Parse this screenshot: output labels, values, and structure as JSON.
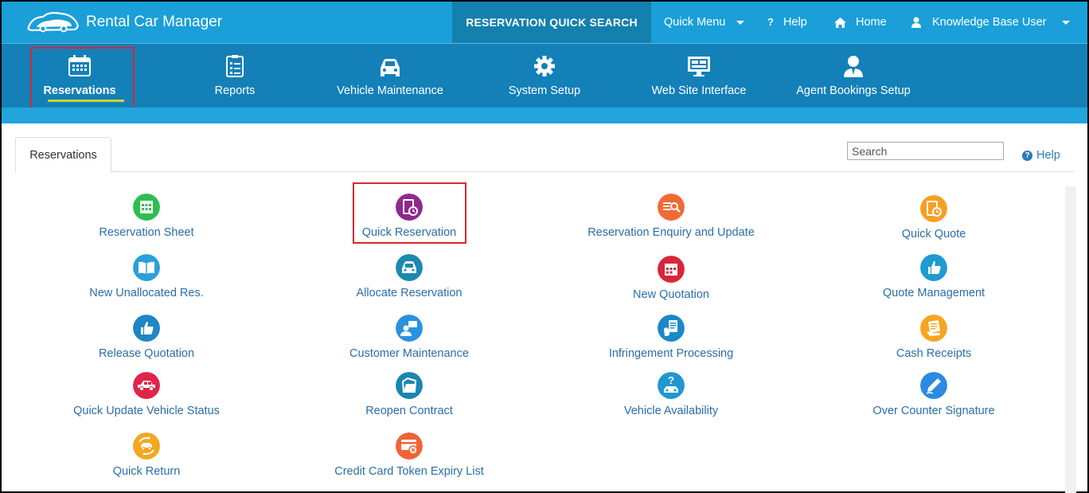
{
  "topbar": {
    "app_title": "Rental Car Manager",
    "quick_search": "RESERVATION QUICK SEARCH",
    "quick_menu": "Quick Menu",
    "help": "Help",
    "home": "Home",
    "user": "Knowledge Base User"
  },
  "nav": {
    "items": [
      {
        "label": "Reservations",
        "icon": "calendar-icon"
      },
      {
        "label": "Reports",
        "icon": "checklist-icon"
      },
      {
        "label": "Vehicle Maintenance",
        "icon": "car-icon"
      },
      {
        "label": "System Setup",
        "icon": "gear-icon"
      },
      {
        "label": "Web Site Interface",
        "icon": "monitor-icon"
      },
      {
        "label": "Agent Bookings Setup",
        "icon": "agent-icon"
      }
    ]
  },
  "content": {
    "tab": "Reservations",
    "search_placeholder": "Search",
    "help": "Help",
    "tiles": [
      {
        "label": "Reservation Sheet",
        "color": "#2ebd4f",
        "icon": "calendar-grid-icon"
      },
      {
        "label": "Quick Reservation",
        "color": "#8e2a8e",
        "icon": "clipboard-clock-icon"
      },
      {
        "label": "Reservation Enquiry and Update",
        "color": "#f06a35",
        "icon": "list-search-icon"
      },
      {
        "label": "Quick Quote",
        "color": "#f6a023",
        "icon": "clipboard-timer-icon"
      },
      {
        "label": "New Unallocated Res.",
        "color": "#2aa0d8",
        "icon": "open-book-icon"
      },
      {
        "label": "Allocate Reservation",
        "color": "#1a8ab0",
        "icon": "car-front-icon"
      },
      {
        "label": "New Quotation",
        "color": "#d8253a",
        "icon": "calendar-red-icon"
      },
      {
        "label": "Quote Management",
        "color": "#1f9bd0",
        "icon": "thumbs-up-icon"
      },
      {
        "label": "Release Quotation",
        "color": "#1f86c4",
        "icon": "thumbs-up-blue-icon"
      },
      {
        "label": "Customer Maintenance",
        "color": "#2893dd",
        "icon": "person-chat-icon"
      },
      {
        "label": "Infringement Processing",
        "color": "#1b88c8",
        "icon": "document-hand-icon"
      },
      {
        "label": "Cash Receipts",
        "color": "#f7a51f",
        "icon": "receipt-icon"
      },
      {
        "label": "Quick Update Vehicle Status",
        "color": "#e0254a",
        "icon": "car-side-icon"
      },
      {
        "label": "Reopen Contract",
        "color": "#1a86b0",
        "icon": "folder-open-icon"
      },
      {
        "label": "Vehicle Availability",
        "color": "#1f98cf",
        "icon": "car-question-icon"
      },
      {
        "label": "Over Counter Signature",
        "color": "#2a8be0",
        "icon": "pen-icon"
      },
      {
        "label": "Quick Return",
        "color": "#f2a81f",
        "icon": "car-return-icon"
      },
      {
        "label": "Credit Card Token Expiry List",
        "color": "#f06336",
        "icon": "credit-card-x-icon"
      }
    ]
  }
}
